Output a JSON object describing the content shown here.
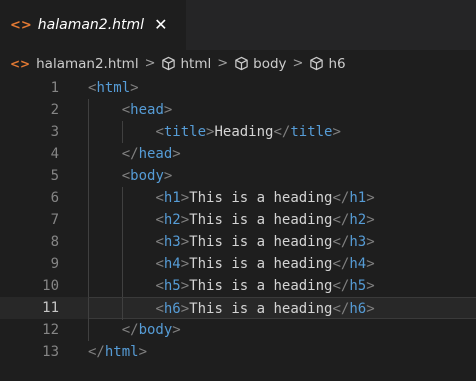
{
  "tab": {
    "icon": "html-file-icon",
    "filename": "halaman2.html",
    "close_glyph": "✕"
  },
  "breadcrumb": {
    "items": [
      "halaman2.html",
      "html",
      "body",
      "h6"
    ],
    "separator": ">"
  },
  "colors": {
    "background": "#1e1e1e",
    "tag": "#569cd6",
    "bracket": "#808080",
    "text": "#d4d4d4",
    "html_icon": "#e37933"
  },
  "editor": {
    "current_line": 11,
    "lines": [
      {
        "n": "1",
        "indent": 0,
        "parts": [
          [
            "b",
            "<"
          ],
          [
            "t",
            "html"
          ],
          [
            "b",
            ">"
          ]
        ]
      },
      {
        "n": "2",
        "indent": 1,
        "parts": [
          [
            "b",
            "<"
          ],
          [
            "t",
            "head"
          ],
          [
            "b",
            ">"
          ]
        ]
      },
      {
        "n": "3",
        "indent": 2,
        "parts": [
          [
            "b",
            "<"
          ],
          [
            "t",
            "title"
          ],
          [
            "b",
            ">"
          ],
          [
            "x",
            "Heading"
          ],
          [
            "b",
            "</"
          ],
          [
            "t",
            "title"
          ],
          [
            "b",
            ">"
          ]
        ]
      },
      {
        "n": "4",
        "indent": 1,
        "parts": [
          [
            "b",
            "</"
          ],
          [
            "t",
            "head"
          ],
          [
            "b",
            ">"
          ]
        ]
      },
      {
        "n": "5",
        "indent": 1,
        "parts": [
          [
            "b",
            "<"
          ],
          [
            "t",
            "body"
          ],
          [
            "b",
            ">"
          ]
        ]
      },
      {
        "n": "6",
        "indent": 2,
        "parts": [
          [
            "b",
            "<"
          ],
          [
            "t",
            "h1"
          ],
          [
            "b",
            ">"
          ],
          [
            "x",
            "This is a heading"
          ],
          [
            "b",
            "</"
          ],
          [
            "t",
            "h1"
          ],
          [
            "b",
            ">"
          ]
        ]
      },
      {
        "n": "7",
        "indent": 2,
        "parts": [
          [
            "b",
            "<"
          ],
          [
            "t",
            "h2"
          ],
          [
            "b",
            ">"
          ],
          [
            "x",
            "This is a heading"
          ],
          [
            "b",
            "</"
          ],
          [
            "t",
            "h2"
          ],
          [
            "b",
            ">"
          ]
        ]
      },
      {
        "n": "8",
        "indent": 2,
        "parts": [
          [
            "b",
            "<"
          ],
          [
            "t",
            "h3"
          ],
          [
            "b",
            ">"
          ],
          [
            "x",
            "This is a heading"
          ],
          [
            "b",
            "</"
          ],
          [
            "t",
            "h3"
          ],
          [
            "b",
            ">"
          ]
        ]
      },
      {
        "n": "9",
        "indent": 2,
        "parts": [
          [
            "b",
            "<"
          ],
          [
            "t",
            "h4"
          ],
          [
            "b",
            ">"
          ],
          [
            "x",
            "This is a heading"
          ],
          [
            "b",
            "</"
          ],
          [
            "t",
            "h4"
          ],
          [
            "b",
            ">"
          ]
        ]
      },
      {
        "n": "10",
        "indent": 2,
        "parts": [
          [
            "b",
            "<"
          ],
          [
            "t",
            "h5"
          ],
          [
            "b",
            ">"
          ],
          [
            "x",
            "This is a heading"
          ],
          [
            "b",
            "</"
          ],
          [
            "t",
            "h5"
          ],
          [
            "b",
            ">"
          ]
        ]
      },
      {
        "n": "11",
        "indent": 2,
        "parts": [
          [
            "b",
            "<"
          ],
          [
            "t",
            "h6"
          ],
          [
            "b",
            ">"
          ],
          [
            "x",
            "This is a heading"
          ],
          [
            "b",
            "</"
          ],
          [
            "t",
            "h6"
          ],
          [
            "b",
            ">"
          ]
        ]
      },
      {
        "n": "12",
        "indent": 1,
        "parts": [
          [
            "b",
            "</"
          ],
          [
            "t",
            "body"
          ],
          [
            "b",
            ">"
          ]
        ]
      },
      {
        "n": "13",
        "indent": 0,
        "parts": [
          [
            "b",
            "</"
          ],
          [
            "t",
            "html"
          ],
          [
            "b",
            ">"
          ]
        ]
      }
    ]
  }
}
